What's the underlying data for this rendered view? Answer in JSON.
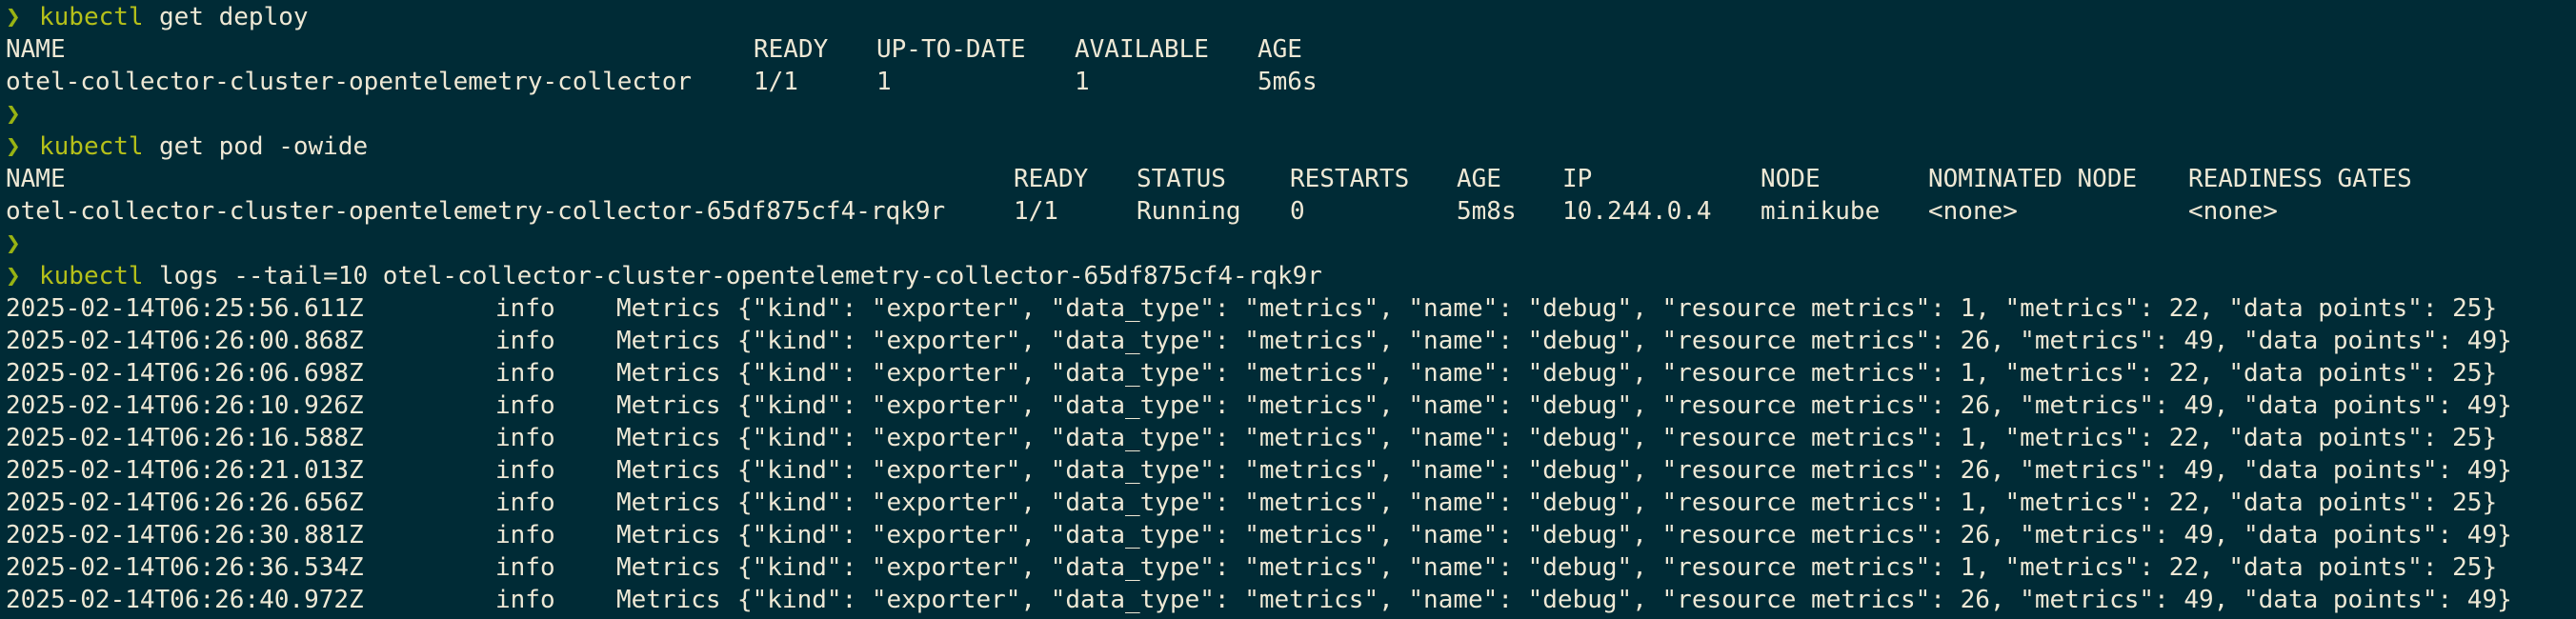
{
  "terminal": {
    "prompt_symbol": "❯",
    "colors": {
      "background": "#002b36",
      "text": "#eee8d5",
      "prompt": "#98b313",
      "command": "#b5c01a"
    }
  },
  "cmd1": {
    "name": "kubectl",
    "args": "get deploy"
  },
  "deploy_table": {
    "headers": [
      "NAME",
      "READY",
      "UP-TO-DATE",
      "AVAILABLE",
      "AGE"
    ],
    "rows": [
      [
        "otel-collector-cluster-opentelemetry-collector",
        "1/1",
        "1",
        "1",
        "5m6s"
      ]
    ]
  },
  "cmd2": {
    "name": "kubectl",
    "args": "get pod -owide"
  },
  "pod_table": {
    "headers": [
      "NAME",
      "READY",
      "STATUS",
      "RESTARTS",
      "AGE",
      "IP",
      "NODE",
      "NOMINATED NODE",
      "READINESS GATES"
    ],
    "rows": [
      [
        "otel-collector-cluster-opentelemetry-collector-65df875cf4-rqk9r",
        "1/1",
        "Running",
        "0",
        "5m8s",
        "10.244.0.4",
        "minikube",
        "<none>",
        "<none>"
      ]
    ]
  },
  "cmd3": {
    "name": "kubectl",
    "args": "logs --tail=10 otel-collector-cluster-opentelemetry-collector-65df875cf4-rqk9r"
  },
  "logs": [
    {
      "ts": "2025-02-14T06:25:56.611Z",
      "level": "info",
      "kind": "Metrics",
      "payload": "{\"kind\": \"exporter\", \"data_type\": \"metrics\", \"name\": \"debug\", \"resource metrics\": 1, \"metrics\": 22, \"data points\": 25}"
    },
    {
      "ts": "2025-02-14T06:26:00.868Z",
      "level": "info",
      "kind": "Metrics",
      "payload": "{\"kind\": \"exporter\", \"data_type\": \"metrics\", \"name\": \"debug\", \"resource metrics\": 26, \"metrics\": 49, \"data points\": 49}"
    },
    {
      "ts": "2025-02-14T06:26:06.698Z",
      "level": "info",
      "kind": "Metrics",
      "payload": "{\"kind\": \"exporter\", \"data_type\": \"metrics\", \"name\": \"debug\", \"resource metrics\": 1, \"metrics\": 22, \"data points\": 25}"
    },
    {
      "ts": "2025-02-14T06:26:10.926Z",
      "level": "info",
      "kind": "Metrics",
      "payload": "{\"kind\": \"exporter\", \"data_type\": \"metrics\", \"name\": \"debug\", \"resource metrics\": 26, \"metrics\": 49, \"data points\": 49}"
    },
    {
      "ts": "2025-02-14T06:26:16.588Z",
      "level": "info",
      "kind": "Metrics",
      "payload": "{\"kind\": \"exporter\", \"data_type\": \"metrics\", \"name\": \"debug\", \"resource metrics\": 1, \"metrics\": 22, \"data points\": 25}"
    },
    {
      "ts": "2025-02-14T06:26:21.013Z",
      "level": "info",
      "kind": "Metrics",
      "payload": "{\"kind\": \"exporter\", \"data_type\": \"metrics\", \"name\": \"debug\", \"resource metrics\": 26, \"metrics\": 49, \"data points\": 49}"
    },
    {
      "ts": "2025-02-14T06:26:26.656Z",
      "level": "info",
      "kind": "Metrics",
      "payload": "{\"kind\": \"exporter\", \"data_type\": \"metrics\", \"name\": \"debug\", \"resource metrics\": 1, \"metrics\": 22, \"data points\": 25}"
    },
    {
      "ts": "2025-02-14T06:26:30.881Z",
      "level": "info",
      "kind": "Metrics",
      "payload": "{\"kind\": \"exporter\", \"data_type\": \"metrics\", \"name\": \"debug\", \"resource metrics\": 26, \"metrics\": 49, \"data points\": 49}"
    },
    {
      "ts": "2025-02-14T06:26:36.534Z",
      "level": "info",
      "kind": "Metrics",
      "payload": "{\"kind\": \"exporter\", \"data_type\": \"metrics\", \"name\": \"debug\", \"resource metrics\": 1, \"metrics\": 22, \"data points\": 25}"
    },
    {
      "ts": "2025-02-14T06:26:40.972Z",
      "level": "info",
      "kind": "Metrics",
      "payload": "{\"kind\": \"exporter\", \"data_type\": \"metrics\", \"name\": \"debug\", \"resource metrics\": 26, \"metrics\": 49, \"data points\": 49}"
    }
  ]
}
